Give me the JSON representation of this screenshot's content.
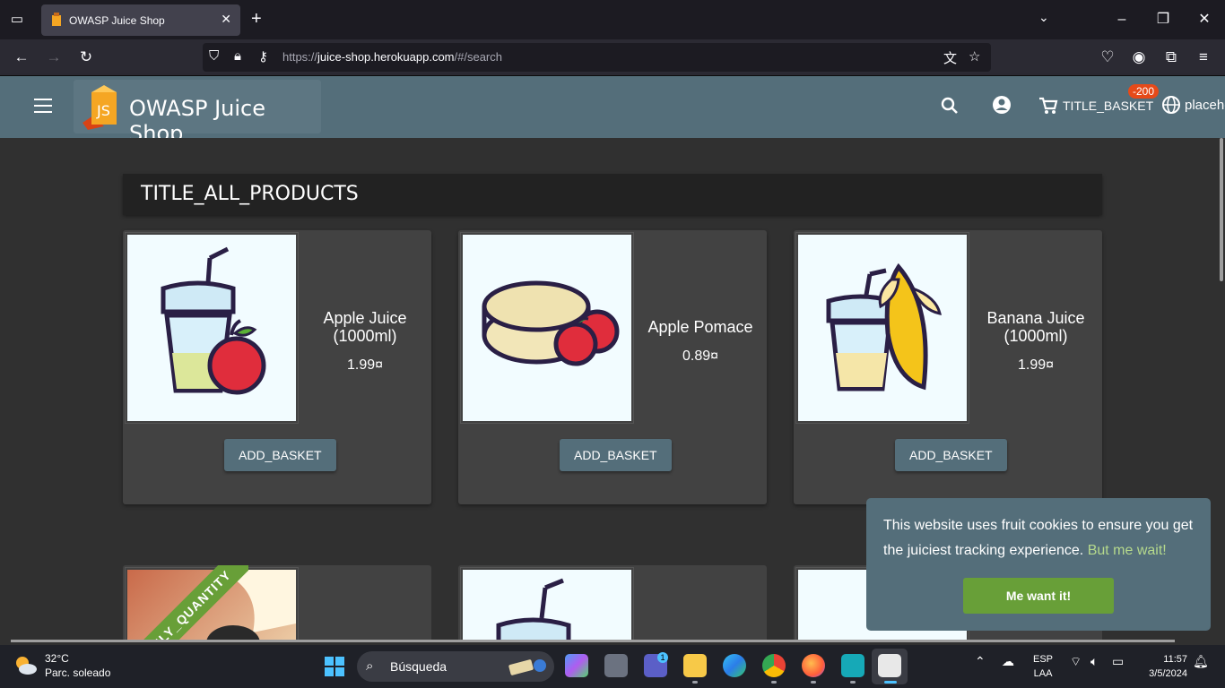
{
  "browser": {
    "tab_title": "OWASP Juice Shop",
    "url_prefix": "https://",
    "url_host": "juice-shop.herokuapp.com",
    "url_path": "/#/search"
  },
  "app": {
    "brand_name": "OWASP Juice Shop",
    "basket_label": "TITLE_BASKET",
    "basket_badge": "-200",
    "language_label": "placeho",
    "accent_color": "#546e7a",
    "button_green": "#689f38"
  },
  "main": {
    "heading": "TITLE_ALL_PRODUCTS",
    "products": [
      {
        "name": "Apple Juice (1000ml)",
        "price": "1.99¤",
        "button": "ADD_BASKET"
      },
      {
        "name": "Apple Pomace",
        "price": "0.89¤",
        "button": "ADD_BASKET"
      },
      {
        "name": "Banana Juice (1000ml)",
        "price": "1.99¤",
        "button": "ADD_BASKET"
      }
    ],
    "ribbon_text": "ONLY_QUANTITY"
  },
  "cookie": {
    "message": "This website uses fruit cookies to ensure you get the juiciest tracking experience.",
    "link": "But me wait!",
    "button": "Me want it!"
  },
  "taskbar": {
    "weather_temp": "32°C",
    "weather_desc": "Parc. soleado",
    "search_label": "Búsqueda",
    "lang_1": "ESP",
    "lang_2": "LAA",
    "time": "11:57",
    "date": "3/5/2024",
    "teams_badge": "1"
  }
}
